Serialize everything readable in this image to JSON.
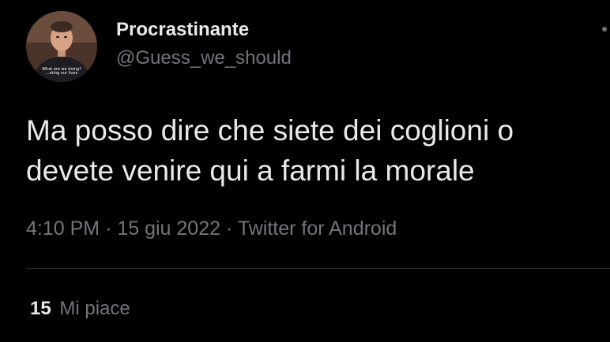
{
  "tweet": {
    "author": {
      "display_name": "Procrastinante",
      "handle": "@Guess_we_should",
      "avatar_caption_line1": "What are we doing?",
      "avatar_caption_line2": "...ating our lives"
    },
    "text": "Ma posso dire che siete dei coglioni o\ndevete venire qui a farmi la morale",
    "time": "4:10 PM",
    "separator": "·",
    "date": "15 giu 2022",
    "source": "Twitter for Android",
    "likes_count": "15",
    "likes_label": "Mi piace"
  },
  "colors": {
    "background": "#000000",
    "primary_text": "#e7e9ea",
    "secondary_text": "#71767b",
    "divider": "#2f3336"
  }
}
